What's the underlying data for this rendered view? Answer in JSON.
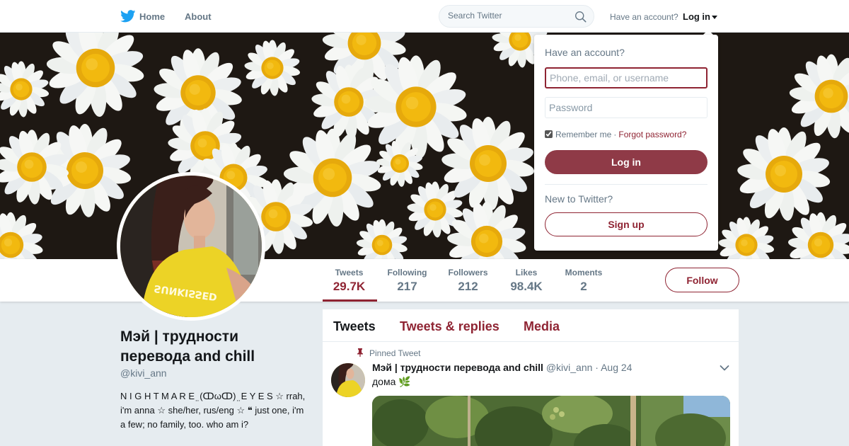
{
  "topnav": {
    "home_label": "Home",
    "about_label": "About",
    "search_placeholder": "Search Twitter",
    "have_account": "Have an account?",
    "login_label": "Log in"
  },
  "profile": {
    "display_name": "Мэй | трудности перевода and chill",
    "handle": "@kivi_ann",
    "bio": "N I G H T M A R E ̤ (ↀωↀ) ̤ E Y E S ☆ rrah, i'm anna ☆ she/her, rus/eng ☆ ❝ just one, i'm a few; no family, too. who am i?",
    "avatar_shirt_text": "SUNKISSED"
  },
  "stats": [
    {
      "label": "Tweets",
      "value": "29.7K"
    },
    {
      "label": "Following",
      "value": "217"
    },
    {
      "label": "Followers",
      "value": "212"
    },
    {
      "label": "Likes",
      "value": "98.4K"
    },
    {
      "label": "Moments",
      "value": "2"
    }
  ],
  "follow_label": "Follow",
  "timeline": {
    "tabs": [
      "Tweets",
      "Tweets & replies",
      "Media"
    ],
    "pinned_label": "Pinned Tweet",
    "tweet": {
      "name": "Мэй | трудности перевода and chill",
      "handle": "@kivi_ann",
      "date": "· Aug 24",
      "text": "дома 🌿"
    }
  },
  "login_dropdown": {
    "title": "Have an account?",
    "username_placeholder": "Phone, email, or username",
    "password_placeholder": "Password",
    "remember_label": "Remember me",
    "separator": "·",
    "forgot_label": "Forgot password?",
    "login_button": "Log in",
    "new_label": "New to Twitter?",
    "signup_button": "Sign up"
  },
  "colors": {
    "accent": "#8f2433",
    "login_button_bg": "#8f3a47",
    "text_secondary": "#657786",
    "background": "#e6ecf0"
  }
}
